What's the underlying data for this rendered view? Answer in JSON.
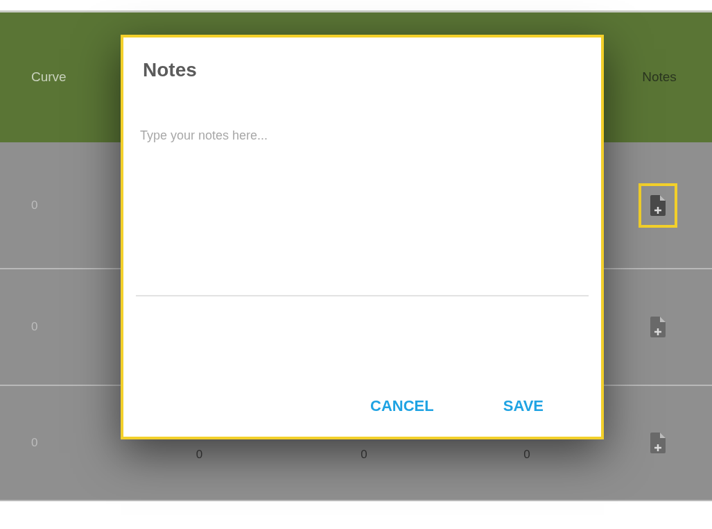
{
  "table": {
    "columns": [
      {
        "label": "Curve"
      },
      {
        "label": "Notes"
      }
    ],
    "rows": [
      {
        "cells": [
          "0"
        ],
        "notes_selected": true
      },
      {
        "cells": [
          "0"
        ],
        "notes_selected": false
      },
      {
        "cells": [
          "0",
          "0",
          "0",
          "0"
        ],
        "notes_selected": false
      }
    ]
  },
  "dialog": {
    "title": "Notes",
    "placeholder": "Type your notes here...",
    "buttons": [
      "CANCEL",
      "SAVE"
    ]
  }
}
